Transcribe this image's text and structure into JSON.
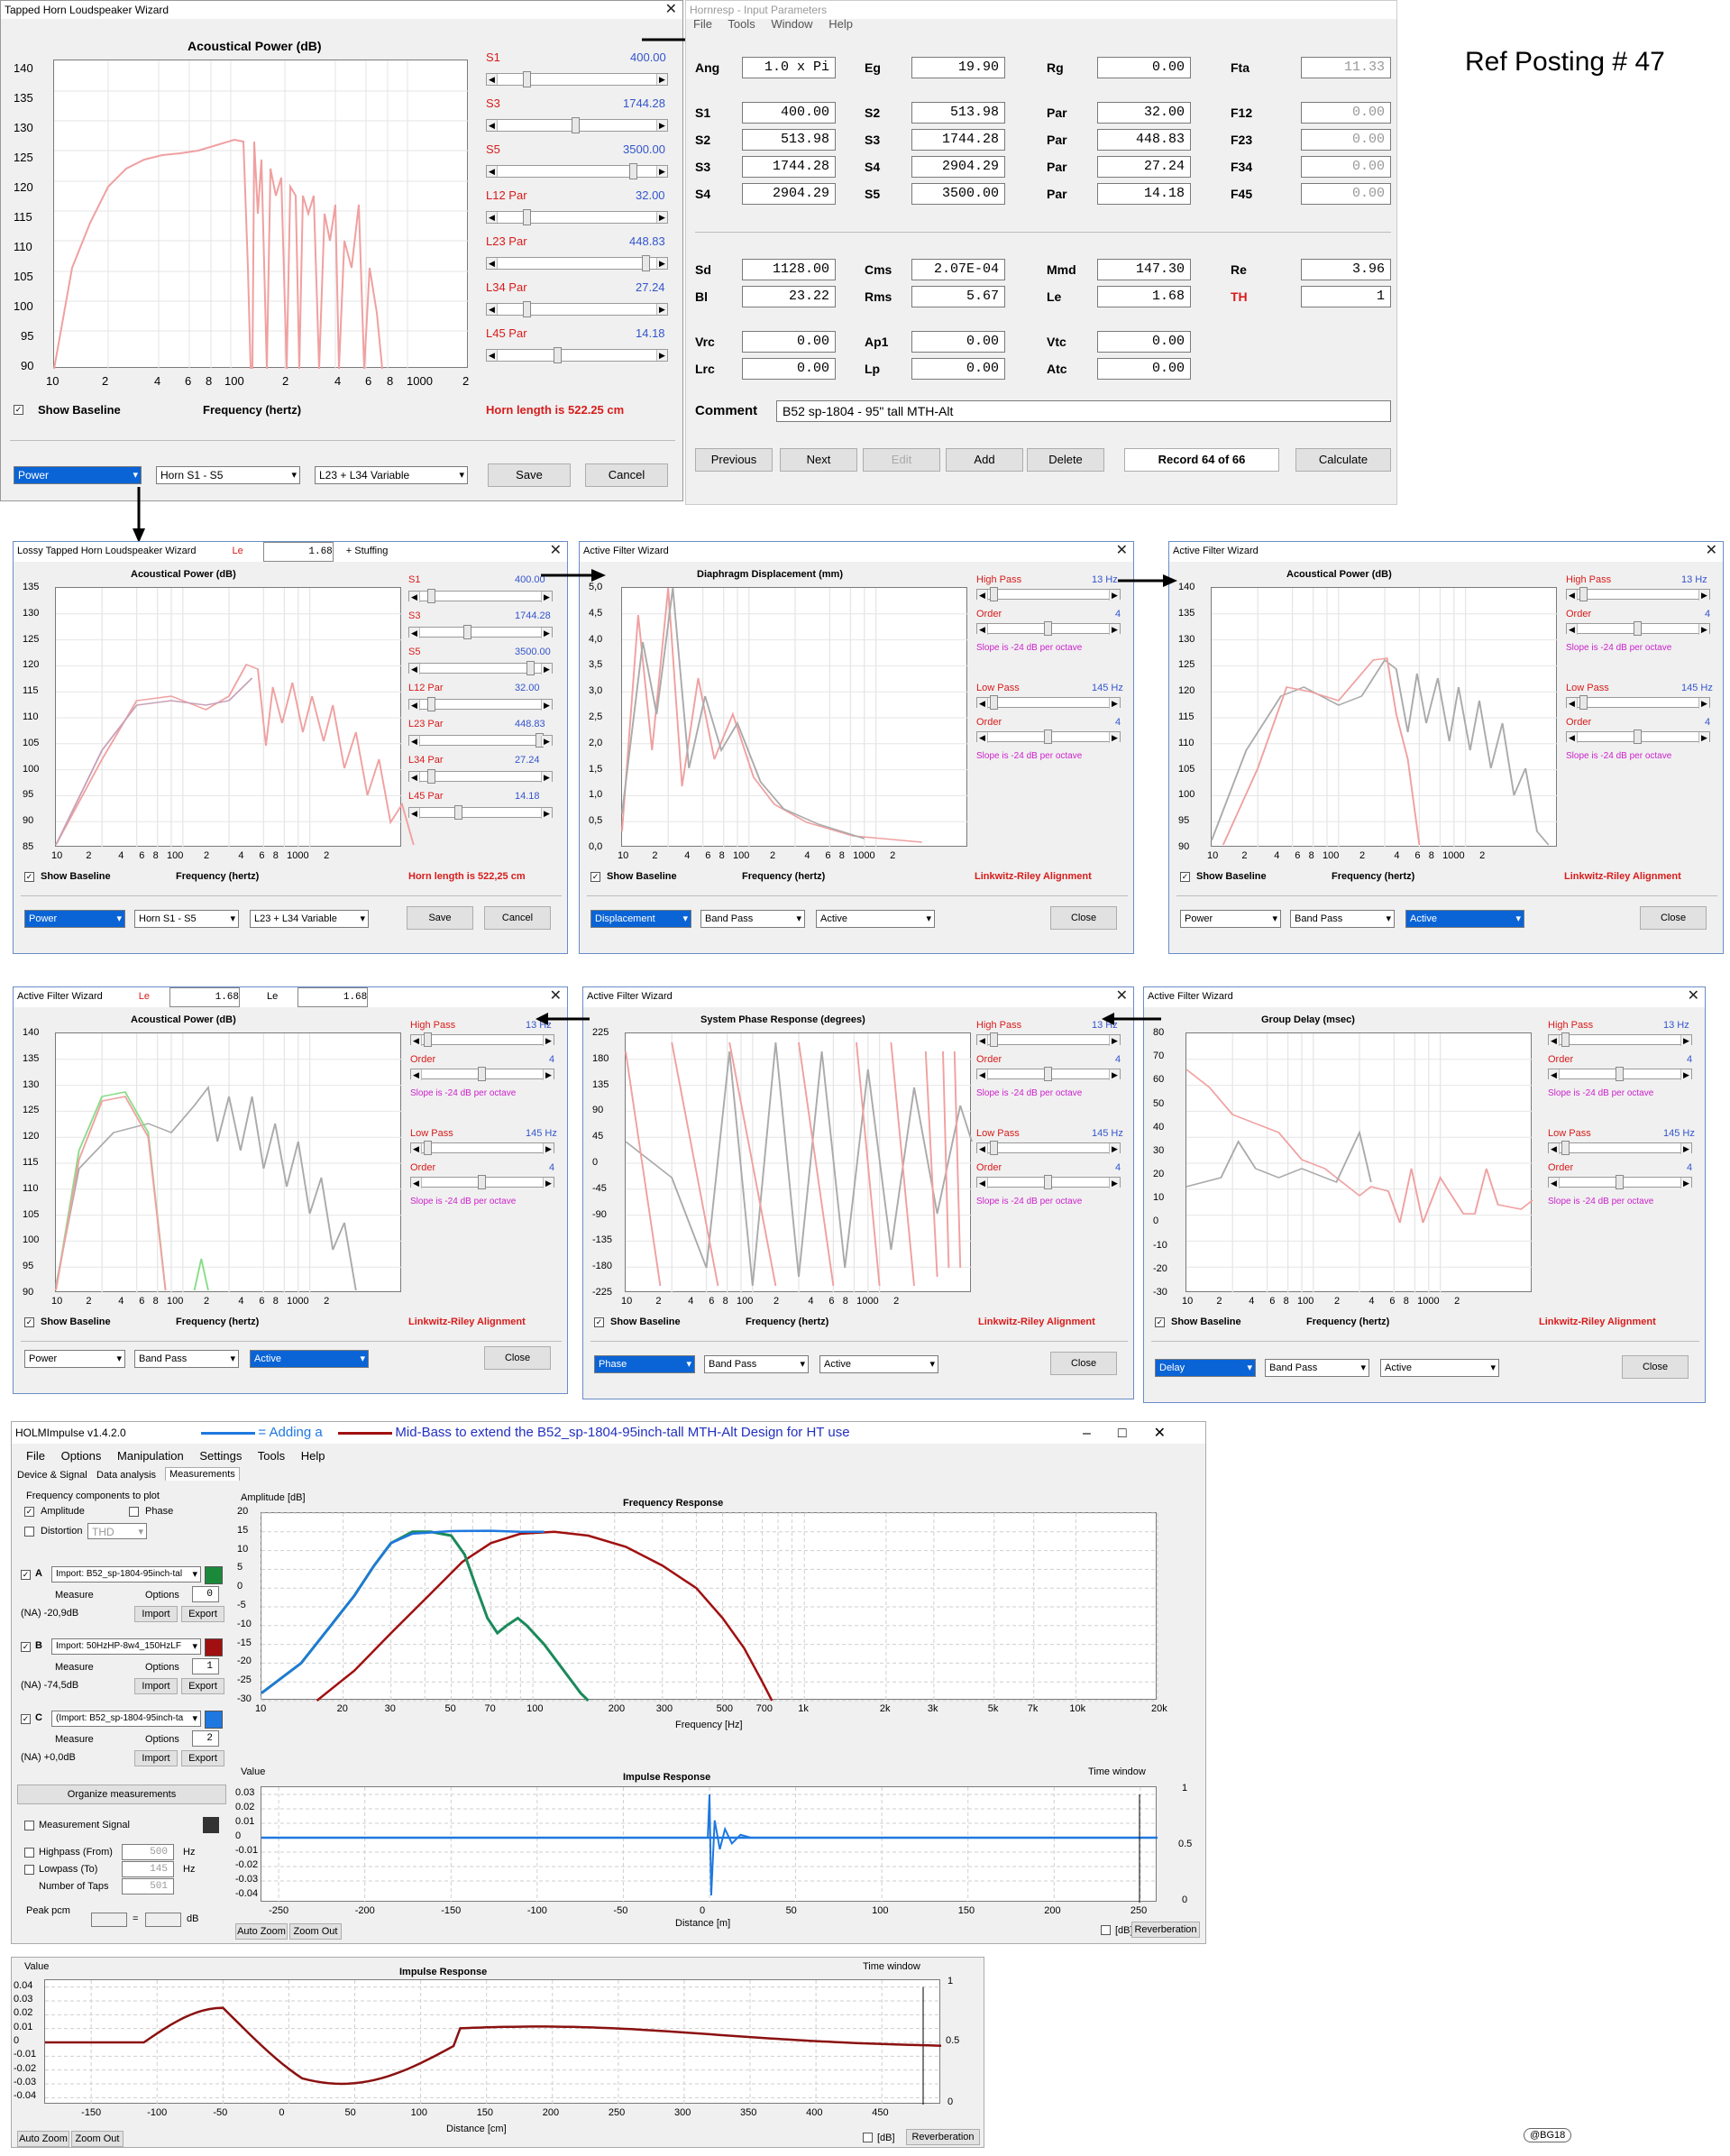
{
  "ref_posting": "Ref Posting # 47",
  "watermark": "@BG18",
  "main_horn": {
    "title": "Tapped Horn Loudspeaker Wizard",
    "chart_title": "Acoustical Power (dB)",
    "y_ticks": [
      "140",
      "135",
      "130",
      "125",
      "120",
      "115",
      "110",
      "105",
      "100",
      "95",
      "90"
    ],
    "x_ticks": [
      "10",
      "2",
      "4",
      "6",
      "8",
      "100",
      "2",
      "4",
      "6",
      "8",
      "1000",
      "2"
    ],
    "show_baseline": "Show Baseline",
    "xlabel": "Frequency (hertz)",
    "horn_length": "Horn length is 522.25 cm",
    "sliders": [
      {
        "label": "S1",
        "value": "400.00"
      },
      {
        "label": "S3",
        "value": "1744.28"
      },
      {
        "label": "S5",
        "value": "3500.00"
      },
      {
        "label": "L12  Par",
        "value": "32.00"
      },
      {
        "label": "L23  Par",
        "value": "448.83"
      },
      {
        "label": "L34  Par",
        "value": "27.24"
      },
      {
        "label": "L45  Par",
        "value": "14.18"
      }
    ],
    "combos": [
      "Power",
      "Horn S1 - S5",
      "L23 + L34 Variable"
    ],
    "save": "Save",
    "cancel": "Cancel"
  },
  "input_params": {
    "title": "Hornresp - Input Parameters",
    "menu": [
      "File",
      "Tools",
      "Window",
      "Help"
    ],
    "rows": [
      [
        [
          "Ang",
          "1.0 x Pi"
        ],
        [
          "Eg",
          "19.90"
        ],
        [
          "Rg",
          "0.00"
        ],
        [
          "Fta",
          "11.33"
        ]
      ],
      [
        [
          "S1",
          "400.00"
        ],
        [
          "S2",
          "513.98"
        ],
        [
          "Par",
          "32.00"
        ],
        [
          "F12",
          "0.00"
        ]
      ],
      [
        [
          "S2",
          "513.98"
        ],
        [
          "S3",
          "1744.28"
        ],
        [
          "Par",
          "448.83"
        ],
        [
          "F23",
          "0.00"
        ]
      ],
      [
        [
          "S3",
          "1744.28"
        ],
        [
          "S4",
          "2904.29"
        ],
        [
          "Par",
          "27.24"
        ],
        [
          "F34",
          "0.00"
        ]
      ],
      [
        [
          "S4",
          "2904.29"
        ],
        [
          "S5",
          "3500.00"
        ],
        [
          "Par",
          "14.18"
        ],
        [
          "F45",
          "0.00"
        ]
      ],
      [
        [
          "Sd",
          "1128.00"
        ],
        [
          "Cms",
          "2.07E-04"
        ],
        [
          "Mmd",
          "147.30"
        ],
        [
          "Re",
          "3.96"
        ]
      ],
      [
        [
          "Bl",
          "23.22"
        ],
        [
          "Rms",
          "5.67"
        ],
        [
          "Le",
          "1.68"
        ],
        [
          "TH",
          "1"
        ]
      ],
      [
        [
          "Vrc",
          "0.00"
        ],
        [
          "Ap1",
          "0.00"
        ],
        [
          "Vtc",
          "0.00"
        ]
      ],
      [
        [
          "Lrc",
          "0.00"
        ],
        [
          "Lp",
          "0.00"
        ],
        [
          "Atc",
          "0.00"
        ]
      ]
    ],
    "comment_label": "Comment",
    "comment": "B52 sp-1804 - 95\" tall MTH-Alt",
    "buttons": [
      "Previous",
      "Next",
      "Edit",
      "Add",
      "Delete",
      "Record 64 of 66",
      "Calculate"
    ]
  },
  "panels": [
    {
      "title": "Lossy Tapped Horn Loudspeaker Wizard",
      "le_label": "Le",
      "le_value": "1.68",
      "extra": "+ Stuffing",
      "chart_title": "Acoustical Power (dB)",
      "y_ticks": [
        "135",
        "130",
        "125",
        "120",
        "115",
        "110",
        "105",
        "100",
        "95",
        "90",
        "85"
      ],
      "left_label": "Show Baseline",
      "mid_label": "Frequency (hertz)",
      "right_label": "Horn length is 522,25 cm",
      "combos": [
        "Power",
        "Horn S1 - S5",
        "L23 + L34 Variable"
      ],
      "btn2": "Save",
      "btn": "Cancel"
    },
    {
      "title": "Active Filter Wizard",
      "chart_title": "Diaphragm Displacement (mm)",
      "y_ticks": [
        "5,0",
        "4,5",
        "4,0",
        "3,5",
        "3,0",
        "2,5",
        "2,0",
        "1,5",
        "1,0",
        "0,5",
        "0,0"
      ],
      "left_label": "Show Baseline",
      "mid_label": "Frequency (hertz)",
      "right_label": "Linkwitz-Riley Alignment",
      "combos": [
        "Displacement",
        "Band Pass",
        "Active"
      ],
      "btn": "Close"
    },
    {
      "title": "Active Filter Wizard",
      "chart_title": "Acoustical Power (dB)",
      "y_ticks": [
        "140",
        "135",
        "130",
        "125",
        "120",
        "115",
        "110",
        "105",
        "100",
        "95",
        "90"
      ],
      "left_label": "Show Baseline",
      "mid_label": "Frequency (hertz)",
      "right_label": "Linkwitz-Riley Alignment",
      "combos": [
        "Power",
        "Band Pass",
        "Active"
      ],
      "btn": "Close"
    },
    {
      "title": "Active Filter Wizard",
      "le_label": "Le",
      "le_value": "1.68",
      "le2_label": "Le",
      "le2_value": "1.68",
      "chart_title": "Acoustical Power (dB)",
      "y_ticks": [
        "140",
        "135",
        "130",
        "125",
        "120",
        "115",
        "110",
        "105",
        "100",
        "95",
        "90"
      ],
      "left_label": "Show Baseline",
      "mid_label": "Frequency (hertz)",
      "right_label": "Linkwitz-Riley Alignment",
      "combos": [
        "Power",
        "Band Pass",
        "Active"
      ],
      "btn": "Close"
    },
    {
      "title": "Active Filter Wizard",
      "chart_title": "System Phase Response (degrees)",
      "y_ticks": [
        "225",
        "180",
        "135",
        "90",
        "45",
        "0",
        "-45",
        "-90",
        "-135",
        "-180",
        "-225"
      ],
      "left_label": "Show Baseline",
      "mid_label": "Frequency (hertz)",
      "right_label": "Linkwitz-Riley Alignment",
      "combos": [
        "Phase",
        "Band Pass",
        "Active"
      ],
      "btn": "Close"
    },
    {
      "title": "Active Filter Wizard",
      "chart_title": "Group Delay (msec)",
      "y_ticks": [
        "80",
        "70",
        "60",
        "50",
        "40",
        "30",
        "20",
        "10",
        "0",
        "-10",
        "-20",
        "-30"
      ],
      "left_label": "Show Baseline",
      "mid_label": "Frequency (hertz)",
      "right_label": "Linkwitz-Riley Alignment",
      "combos": [
        "Delay",
        "Band Pass",
        "Active"
      ],
      "btn": "Close"
    }
  ],
  "filter_controls": {
    "high_pass": "High Pass",
    "hp_value": "13 Hz",
    "order": "Order",
    "order_value": "4",
    "slope": "Slope is -24 dB per octave",
    "low_pass": "Low Pass",
    "lp_value": "145 Hz"
  },
  "small_x_ticks": [
    "10",
    "2",
    "4",
    "6",
    "8",
    "100",
    "2",
    "4",
    "6",
    "8",
    "1000",
    "2"
  ],
  "holm": {
    "title": "HOLMImpulse  v1.4.2.0",
    "legend_blue": "= Adding a",
    "legend_red": "Mid-Bass to extend the  B52_sp-1804-95inch-tall MTH-Alt Design for HT use",
    "menu": [
      "File",
      "Options",
      "Manipulation",
      "Settings",
      "Tools",
      "Help"
    ],
    "tabs": [
      "Device & Signal",
      "Data analysis",
      "Measurements"
    ],
    "freq_components": "Frequency components to plot",
    "amplitude": "Amplitude",
    "phase": "Phase",
    "distortion": "Distortion",
    "thd": "THD",
    "measurements": [
      {
        "id": "A",
        "import": "Import: B52_sp-1804-95inch-tal",
        "measure": "Measure",
        "options": "Options",
        "num": "0",
        "level": "(NA) -20,9dB",
        "btn_import": "Import",
        "btn_export": "Export",
        "color": "#1a8a3a"
      },
      {
        "id": "B",
        "import": "Import: 50HzHP-8w4_150HzLF",
        "measure": "Measure",
        "options": "Options",
        "num": "1",
        "level": "(NA) -74,5dB",
        "btn_import": "Import",
        "btn_export": "Export",
        "color": "#a01010"
      },
      {
        "id": "C",
        "import": "(Import: B52_sp-1804-95inch-ta",
        "measure": "Measure",
        "options": "Options",
        "num": "2",
        "level": "(NA) +0,0dB",
        "btn_import": "Import",
        "btn_export": "Export",
        "color": "#1e78e0"
      }
    ],
    "organize": "Organize measurements",
    "meas_signal": "Measurement Signal",
    "highpass": "Highpass (From)",
    "highpass_v": "500",
    "lowpass": "Lowpass (To)",
    "lowpass_v": "145",
    "taps": "Number of Taps",
    "taps_v": "501",
    "hz": "Hz",
    "peak": "Peak pcm",
    "db": "dB",
    "fr_ylabel": "Amplitude [dB]",
    "fr_title": "Frequency Response",
    "fr_y": [
      "20",
      "15",
      "10",
      "5",
      "0",
      "-5",
      "-10",
      "-15",
      "-20",
      "-25",
      "-30"
    ],
    "fr_x": [
      "10",
      "20",
      "30",
      "50",
      "70",
      "100",
      "200",
      "300",
      "500",
      "700",
      "1k",
      "2k",
      "3k",
      "5k",
      "7k",
      "10k",
      "20k"
    ],
    "fr_xlabel": "Frequency [Hz]",
    "ir_ylabel": "Value",
    "ir_title": "Impulse Response",
    "time_window": "Time window",
    "ir_y": [
      "0.03",
      "0.02",
      "0.01",
      "0",
      "-0.01",
      "-0.02",
      "-0.03",
      "-0.04"
    ],
    "ir_x": [
      "-250",
      "-200",
      "-150",
      "-100",
      "-50",
      "0",
      "50",
      "100",
      "150",
      "200",
      "250"
    ],
    "ir_xlabel": "Distance [m]",
    "tw_ticks": [
      "1",
      "0.5",
      "0"
    ],
    "auto_zoom": "Auto Zoom",
    "zoom_out": "Zoom Out",
    "db_label": "[dB]",
    "reverb": "Reverberation"
  },
  "bottom_ir": {
    "ylabel": "Value",
    "title": "Impulse Response",
    "time_window": "Time window",
    "y": [
      "0.04",
      "0.03",
      "0.02",
      "0.01",
      "0",
      "-0.01",
      "-0.02",
      "-0.03",
      "-0.04"
    ],
    "x": [
      "-150",
      "-100",
      "-50",
      "0",
      "50",
      "100",
      "150",
      "200",
      "250",
      "300",
      "350",
      "400",
      "450"
    ],
    "xlabel": "Distance [cm]",
    "tw_ticks": [
      "1",
      "0.5",
      "0"
    ],
    "auto_zoom": "Auto Zoom",
    "zoom_out": "Zoom Out",
    "db_label": "[dB]",
    "reverb": "Reverberation"
  }
}
